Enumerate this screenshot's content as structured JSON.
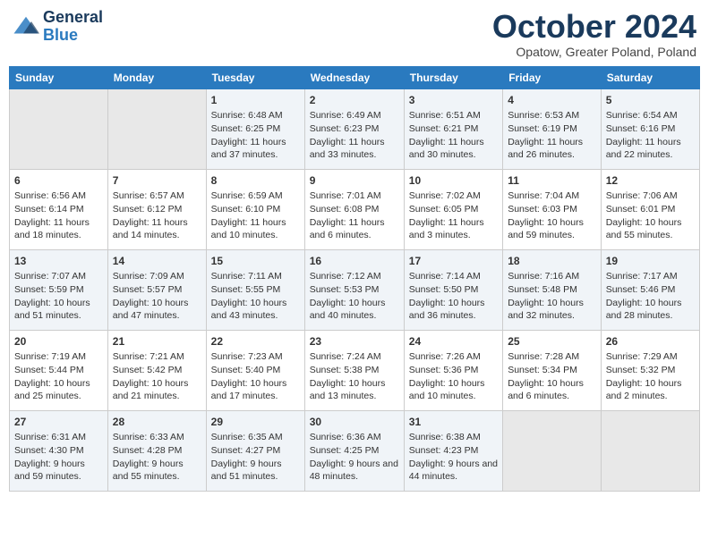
{
  "header": {
    "logo_line1": "General",
    "logo_line2": "Blue",
    "month": "October 2024",
    "location": "Opatow, Greater Poland, Poland"
  },
  "days_of_week": [
    "Sunday",
    "Monday",
    "Tuesday",
    "Wednesday",
    "Thursday",
    "Friday",
    "Saturday"
  ],
  "weeks": [
    [
      {
        "day": "",
        "content": ""
      },
      {
        "day": "",
        "content": ""
      },
      {
        "day": "1",
        "content": "Sunrise: 6:48 AM\nSunset: 6:25 PM\nDaylight: 11 hours and 37 minutes."
      },
      {
        "day": "2",
        "content": "Sunrise: 6:49 AM\nSunset: 6:23 PM\nDaylight: 11 hours and 33 minutes."
      },
      {
        "day": "3",
        "content": "Sunrise: 6:51 AM\nSunset: 6:21 PM\nDaylight: 11 hours and 30 minutes."
      },
      {
        "day": "4",
        "content": "Sunrise: 6:53 AM\nSunset: 6:19 PM\nDaylight: 11 hours and 26 minutes."
      },
      {
        "day": "5",
        "content": "Sunrise: 6:54 AM\nSunset: 6:16 PM\nDaylight: 11 hours and 22 minutes."
      }
    ],
    [
      {
        "day": "6",
        "content": "Sunrise: 6:56 AM\nSunset: 6:14 PM\nDaylight: 11 hours and 18 minutes."
      },
      {
        "day": "7",
        "content": "Sunrise: 6:57 AM\nSunset: 6:12 PM\nDaylight: 11 hours and 14 minutes."
      },
      {
        "day": "8",
        "content": "Sunrise: 6:59 AM\nSunset: 6:10 PM\nDaylight: 11 hours and 10 minutes."
      },
      {
        "day": "9",
        "content": "Sunrise: 7:01 AM\nSunset: 6:08 PM\nDaylight: 11 hours and 6 minutes."
      },
      {
        "day": "10",
        "content": "Sunrise: 7:02 AM\nSunset: 6:05 PM\nDaylight: 11 hours and 3 minutes."
      },
      {
        "day": "11",
        "content": "Sunrise: 7:04 AM\nSunset: 6:03 PM\nDaylight: 10 hours and 59 minutes."
      },
      {
        "day": "12",
        "content": "Sunrise: 7:06 AM\nSunset: 6:01 PM\nDaylight: 10 hours and 55 minutes."
      }
    ],
    [
      {
        "day": "13",
        "content": "Sunrise: 7:07 AM\nSunset: 5:59 PM\nDaylight: 10 hours and 51 minutes."
      },
      {
        "day": "14",
        "content": "Sunrise: 7:09 AM\nSunset: 5:57 PM\nDaylight: 10 hours and 47 minutes."
      },
      {
        "day": "15",
        "content": "Sunrise: 7:11 AM\nSunset: 5:55 PM\nDaylight: 10 hours and 43 minutes."
      },
      {
        "day": "16",
        "content": "Sunrise: 7:12 AM\nSunset: 5:53 PM\nDaylight: 10 hours and 40 minutes."
      },
      {
        "day": "17",
        "content": "Sunrise: 7:14 AM\nSunset: 5:50 PM\nDaylight: 10 hours and 36 minutes."
      },
      {
        "day": "18",
        "content": "Sunrise: 7:16 AM\nSunset: 5:48 PM\nDaylight: 10 hours and 32 minutes."
      },
      {
        "day": "19",
        "content": "Sunrise: 7:17 AM\nSunset: 5:46 PM\nDaylight: 10 hours and 28 minutes."
      }
    ],
    [
      {
        "day": "20",
        "content": "Sunrise: 7:19 AM\nSunset: 5:44 PM\nDaylight: 10 hours and 25 minutes."
      },
      {
        "day": "21",
        "content": "Sunrise: 7:21 AM\nSunset: 5:42 PM\nDaylight: 10 hours and 21 minutes."
      },
      {
        "day": "22",
        "content": "Sunrise: 7:23 AM\nSunset: 5:40 PM\nDaylight: 10 hours and 17 minutes."
      },
      {
        "day": "23",
        "content": "Sunrise: 7:24 AM\nSunset: 5:38 PM\nDaylight: 10 hours and 13 minutes."
      },
      {
        "day": "24",
        "content": "Sunrise: 7:26 AM\nSunset: 5:36 PM\nDaylight: 10 hours and 10 minutes."
      },
      {
        "day": "25",
        "content": "Sunrise: 7:28 AM\nSunset: 5:34 PM\nDaylight: 10 hours and 6 minutes."
      },
      {
        "day": "26",
        "content": "Sunrise: 7:29 AM\nSunset: 5:32 PM\nDaylight: 10 hours and 2 minutes."
      }
    ],
    [
      {
        "day": "27",
        "content": "Sunrise: 6:31 AM\nSunset: 4:30 PM\nDaylight: 9 hours and 59 minutes."
      },
      {
        "day": "28",
        "content": "Sunrise: 6:33 AM\nSunset: 4:28 PM\nDaylight: 9 hours and 55 minutes."
      },
      {
        "day": "29",
        "content": "Sunrise: 6:35 AM\nSunset: 4:27 PM\nDaylight: 9 hours and 51 minutes."
      },
      {
        "day": "30",
        "content": "Sunrise: 6:36 AM\nSunset: 4:25 PM\nDaylight: 9 hours and 48 minutes."
      },
      {
        "day": "31",
        "content": "Sunrise: 6:38 AM\nSunset: 4:23 PM\nDaylight: 9 hours and 44 minutes."
      },
      {
        "day": "",
        "content": ""
      },
      {
        "day": "",
        "content": ""
      }
    ]
  ]
}
